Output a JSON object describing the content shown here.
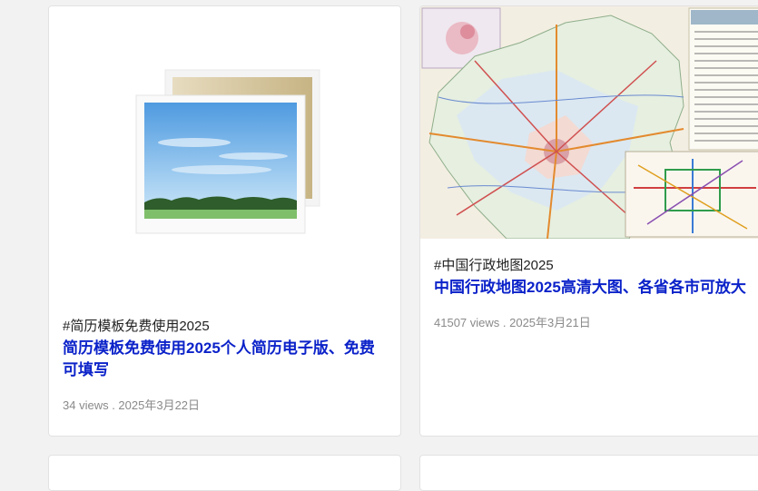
{
  "cards": [
    {
      "tag": "#简历模板免费使用2025",
      "title": "简历模板免费使用2025个人简历电子版、免费可填写",
      "meta": "34 views . 2025年3月22日",
      "thumbnail_icon": "image-placeholder-icon"
    },
    {
      "tag": "#中国行政地图2025",
      "title": "中国行政地图2025高清大图、各省各市可放大",
      "meta": "41507 views . 2025年3月21日",
      "thumbnail_icon": "map-image"
    }
  ],
  "colors": {
    "page_bg": "#f2f2f2",
    "card_bg": "#ffffff",
    "title_link": "#0b22c9",
    "meta_text": "#8a8a8a"
  }
}
